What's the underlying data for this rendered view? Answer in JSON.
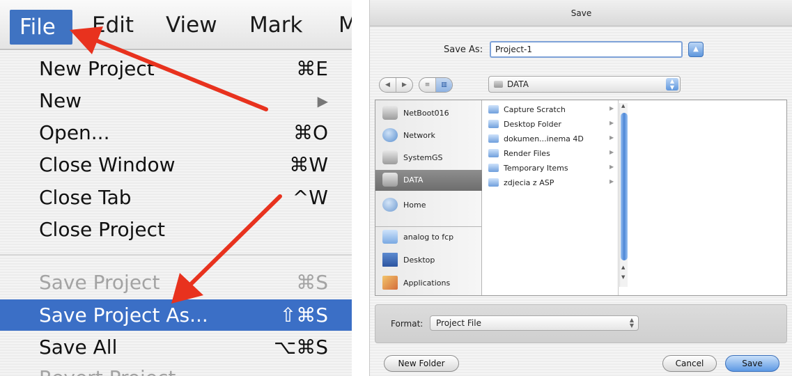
{
  "menu": {
    "bar": [
      "File",
      "Edit",
      "View",
      "Mark",
      "M"
    ],
    "items": [
      {
        "label": "New Project",
        "key": "⌘E",
        "state": "normal"
      },
      {
        "label": "New",
        "key": "▶",
        "state": "normal"
      },
      {
        "label": "Open...",
        "key": "⌘O",
        "state": "normal"
      },
      {
        "label": "Close Window",
        "key": "⌘W",
        "state": "normal"
      },
      {
        "label": "Close Tab",
        "key": "^W",
        "state": "normal"
      },
      {
        "label": "Close Project",
        "key": "",
        "state": "normal"
      },
      {
        "label": "Save Project",
        "key": "⌘S",
        "state": "disabled"
      },
      {
        "label": "Save Project As...",
        "key": "⇧⌘S",
        "state": "selected"
      },
      {
        "label": "Save All",
        "key": "⌥⌘S",
        "state": "normal"
      },
      {
        "label": "Revert Project",
        "key": "",
        "state": "disabled"
      }
    ]
  },
  "dialog": {
    "title": "Save",
    "save_as_label": "Save As:",
    "save_as_value": "Project-1",
    "nav_back": "◀",
    "nav_forward": "▶",
    "location": "DATA",
    "sidebar": [
      {
        "label": "NetBoot016",
        "icon": "drive-icon"
      },
      {
        "label": "Network",
        "icon": "network-icon"
      },
      {
        "label": "SystemGS",
        "icon": "disk-icon"
      },
      {
        "label": "DATA",
        "icon": "drive-icon",
        "selected": true
      },
      {
        "label": "Home",
        "icon": "home-icon"
      },
      {
        "label": "analog to fcp",
        "icon": "folder-icon"
      },
      {
        "label": "Desktop",
        "icon": "desktop-icon"
      },
      {
        "label": "Applications",
        "icon": "applications-icon"
      }
    ],
    "files": [
      "Capture Scratch",
      "Desktop Folder",
      "dokumen...inema 4D",
      "Render Files",
      "Temporary Items",
      "zdjecia z ASP"
    ],
    "format_label": "Format:",
    "format_value": "Project File",
    "buttons": {
      "new_folder": "New Folder",
      "cancel": "Cancel",
      "save": "Save"
    }
  },
  "colors": {
    "menu_highlight": "#3b6fc6",
    "annotation_arrow": "#e8321e",
    "aqua_blue": "#5d98e4"
  }
}
